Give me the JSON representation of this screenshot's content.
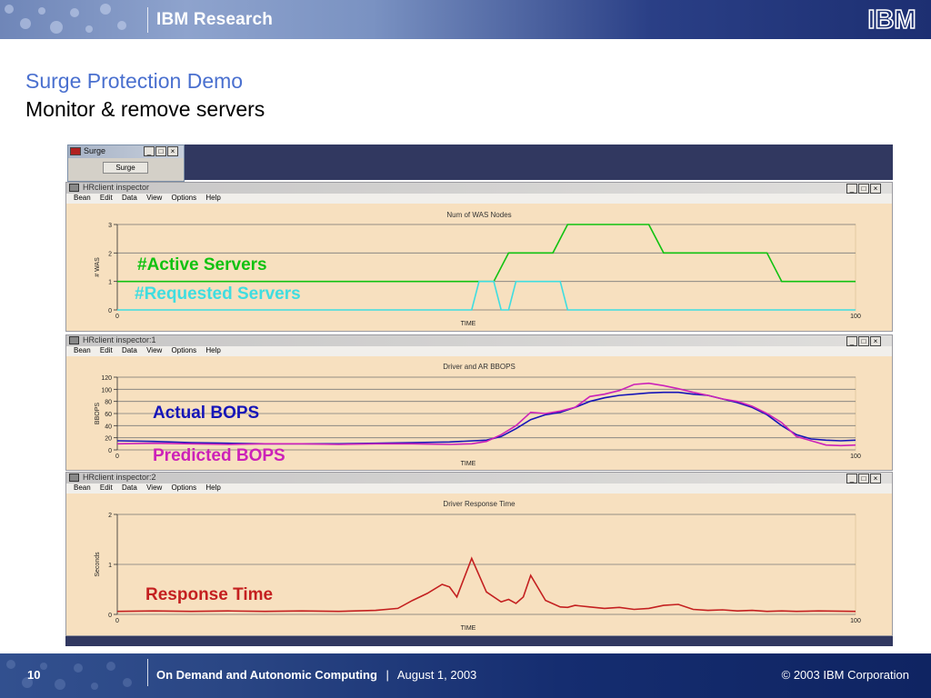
{
  "header": {
    "brand": "IBM Research",
    "logo_text": "IBM"
  },
  "slide": {
    "title": "Surge Protection Demo",
    "subtitle": "Monitor & remove servers"
  },
  "surge_window": {
    "title": "Surge",
    "button_label": "Surge"
  },
  "window_controls": {
    "minimize": "_",
    "maximize": "□",
    "close": "×"
  },
  "menu_items": [
    "Bean",
    "Edit",
    "Data",
    "View",
    "Options",
    "Help"
  ],
  "windows": [
    {
      "title": "HRclient inspector",
      "plot_title": "Num of WAS Nodes",
      "y_axis": "# WAS",
      "x_axis": "TIME"
    },
    {
      "title": "HRclient inspector:1",
      "plot_title": "Driver and AR BBOPS",
      "y_axis": "BBOPS",
      "x_axis": "TIME"
    },
    {
      "title": "HRclient inspector:2",
      "plot_title": "Driver Response Time",
      "y_axis": "Seconds",
      "x_axis": "TIME"
    }
  ],
  "overlay_labels": {
    "active_servers": "#Active Servers",
    "requested_servers": "#Requested Servers",
    "actual_bops": "Actual BOPS",
    "predicted_bops": "Predicted BOPS",
    "response_time": "Response Time"
  },
  "colors": {
    "active": "#11c211",
    "requested": "#3fdde0",
    "actual": "#1515b8",
    "predicted": "#cc22b8",
    "response": "#c42020",
    "title_blue": "#4a70cf"
  },
  "chart_data": [
    {
      "type": "line",
      "title": "Num of WAS Nodes",
      "xlabel": "TIME",
      "ylabel": "# WAS",
      "xlim": [
        0,
        100
      ],
      "ylim": [
        0,
        3
      ],
      "y_ticks": [
        0,
        1,
        2,
        3
      ],
      "x_tick_labels": [
        "0",
        "100"
      ],
      "grid": true,
      "series": [
        {
          "name": "#Active Servers",
          "x": [
            0,
            51,
            53,
            59,
            61,
            72,
            74,
            88,
            90,
            100
          ],
          "y": [
            1,
            1,
            2,
            2,
            3,
            3,
            2,
            2,
            1,
            1
          ]
        },
        {
          "name": "#Requested Servers",
          "x": [
            0,
            48,
            49,
            51,
            52,
            53,
            54,
            55,
            57,
            58,
            60,
            61,
            100
          ],
          "y": [
            0,
            0,
            1,
            1,
            0,
            0,
            1,
            1,
            1,
            1,
            1,
            0,
            0
          ]
        }
      ]
    },
    {
      "type": "line",
      "title": "Driver and AR BBOPS",
      "xlabel": "TIME",
      "ylabel": "BBOPS",
      "xlim": [
        0,
        100
      ],
      "ylim": [
        0,
        120
      ],
      "y_ticks": [
        0,
        20,
        40,
        60,
        80,
        100,
        120
      ],
      "x_tick_labels": [
        "0",
        "100"
      ],
      "grid": true,
      "series": [
        {
          "name": "Actual BOPS",
          "x": [
            0,
            5,
            10,
            15,
            20,
            25,
            30,
            35,
            40,
            45,
            50,
            52,
            54,
            56,
            58,
            60,
            62,
            64,
            66,
            68,
            70,
            72,
            74,
            76,
            78,
            80,
            82,
            84,
            86,
            88,
            90,
            92,
            94,
            96,
            98,
            100
          ],
          "y": [
            15,
            14,
            12,
            11,
            10,
            10,
            10,
            11,
            12,
            13,
            16,
            22,
            35,
            50,
            58,
            62,
            70,
            80,
            86,
            90,
            92,
            94,
            95,
            95,
            92,
            90,
            84,
            78,
            70,
            58,
            40,
            25,
            18,
            16,
            15,
            16
          ]
        },
        {
          "name": "Predicted BOPS",
          "x": [
            0,
            5,
            10,
            15,
            20,
            25,
            30,
            35,
            40,
            45,
            48,
            50,
            52,
            54,
            56,
            58,
            60,
            62,
            64,
            66,
            68,
            70,
            72,
            74,
            76,
            78,
            80,
            82,
            84,
            86,
            88,
            90,
            92,
            94,
            96,
            98,
            100
          ],
          "y": [
            10,
            11,
            10,
            9,
            10,
            10,
            9,
            10,
            10,
            9,
            10,
            14,
            25,
            40,
            62,
            60,
            64,
            70,
            88,
            92,
            98,
            108,
            110,
            106,
            101,
            95,
            90,
            84,
            80,
            72,
            60,
            45,
            22,
            15,
            8,
            7,
            8
          ]
        }
      ]
    },
    {
      "type": "line",
      "title": "Driver Response Time",
      "xlabel": "TIME",
      "ylabel": "Seconds",
      "xlim": [
        0,
        100
      ],
      "ylim": [
        0,
        2
      ],
      "y_ticks": [
        0,
        1,
        2
      ],
      "x_tick_labels": [
        "0",
        "100"
      ],
      "grid": true,
      "series": [
        {
          "name": "Response Time",
          "x": [
            0,
            5,
            10,
            15,
            20,
            25,
            30,
            35,
            38,
            40,
            42,
            44,
            45,
            46,
            48,
            50,
            52,
            53,
            54,
            55,
            56,
            58,
            60,
            61,
            62,
            64,
            66,
            68,
            70,
            72,
            74,
            76,
            78,
            80,
            82,
            84,
            86,
            88,
            90,
            92,
            95,
            100
          ],
          "y": [
            0.06,
            0.07,
            0.06,
            0.07,
            0.06,
            0.07,
            0.06,
            0.08,
            0.12,
            0.28,
            0.42,
            0.6,
            0.55,
            0.35,
            1.12,
            0.45,
            0.25,
            0.3,
            0.22,
            0.35,
            0.78,
            0.28,
            0.15,
            0.14,
            0.18,
            0.15,
            0.12,
            0.14,
            0.1,
            0.12,
            0.18,
            0.2,
            0.1,
            0.08,
            0.09,
            0.07,
            0.08,
            0.06,
            0.07,
            0.06,
            0.07,
            0.06
          ]
        }
      ]
    }
  ],
  "footer": {
    "page_number": "10",
    "title": "On Demand and Autonomic Computing",
    "separator": "|",
    "date": "August 1, 2003",
    "copyright": "© 2003 IBM Corporation"
  }
}
